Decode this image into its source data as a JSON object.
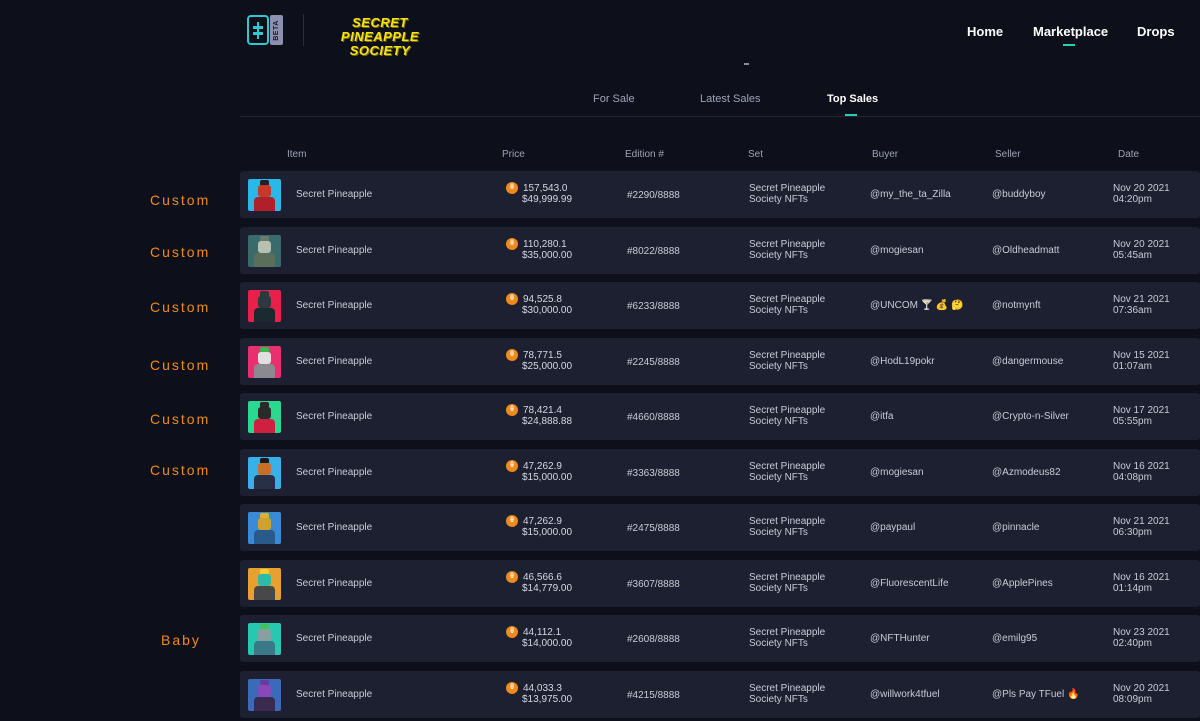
{
  "header": {
    "beta_label": "BETA",
    "brand_line1": "SECRET PINEAPPLE",
    "brand_line2": "SOCIETY",
    "nav": {
      "home": "Home",
      "marketplace": "Marketplace",
      "drops": "Drops"
    },
    "small_dash": "-"
  },
  "tabs": {
    "for_sale": "For Sale",
    "latest_sales": "Latest Sales",
    "top_sales": "Top Sales"
  },
  "columns": {
    "item": "Item",
    "price": "Price",
    "edition": "Edition #",
    "set": "Set",
    "buyer": "Buyer",
    "seller": "Seller",
    "date": "Date"
  },
  "rows": [
    {
      "name": "Secret Pineapple",
      "tfuel": "157,543.0",
      "usd": "$49,999.99",
      "edition": "#2290/8888",
      "set1": "Secret Pineapple",
      "set2": "Society NFTs",
      "buyer": "@my_the_ta_Zilla",
      "seller": "@buddyboy",
      "date1": "Nov 20 2021",
      "date2": "04:20pm",
      "side": "Custom"
    },
    {
      "name": "Secret Pineapple",
      "tfuel": "110,280.1",
      "usd": "$35,000.00",
      "edition": "#8022/8888",
      "set1": "Secret Pineapple",
      "set2": "Society NFTs",
      "buyer": "@mogiesan",
      "seller": "@Oldheadmatt",
      "date1": "Nov 20 2021",
      "date2": "05:45am",
      "side": "Custom"
    },
    {
      "name": "Secret Pineapple",
      "tfuel": "94,525.8",
      "usd": "$30,000.00",
      "edition": "#6233/8888",
      "set1": "Secret Pineapple",
      "set2": "Society NFTs",
      "buyer": "@UNCOM 🍸 💰 🤔",
      "seller": "@notmynft",
      "date1": "Nov 21 2021",
      "date2": "07:36am",
      "side": "Custom"
    },
    {
      "name": "Secret Pineapple",
      "tfuel": "78,771.5",
      "usd": "$25,000.00",
      "edition": "#2245/8888",
      "set1": "Secret Pineapple",
      "set2": "Society NFTs",
      "buyer": "@HodL19pokr",
      "seller": "@dangermouse",
      "date1": "Nov 15 2021",
      "date2": "01:07am",
      "side": "Custom"
    },
    {
      "name": "Secret Pineapple",
      "tfuel": "78,421.4",
      "usd": "$24,888.88",
      "edition": "#4660/8888",
      "set1": "Secret Pineapple",
      "set2": "Society NFTs",
      "buyer": "@itfa",
      "seller": "@Crypto-n-Silver",
      "date1": "Nov 17 2021",
      "date2": "05:55pm",
      "side": "Custom"
    },
    {
      "name": "Secret Pineapple",
      "tfuel": "47,262.9",
      "usd": "$15,000.00",
      "edition": "#3363/8888",
      "set1": "Secret Pineapple",
      "set2": "Society NFTs",
      "buyer": "@mogiesan",
      "seller": "@Azmodeus82",
      "date1": "Nov 16 2021",
      "date2": "04:08pm",
      "side": "Custom"
    },
    {
      "name": "Secret Pineapple",
      "tfuel": "47,262.9",
      "usd": "$15,000.00",
      "edition": "#2475/8888",
      "set1": "Secret Pineapple",
      "set2": "Society NFTs",
      "buyer": "@paypaul",
      "seller": "@pinnacle",
      "date1": "Nov 21 2021",
      "date2": "06:30pm",
      "side": ""
    },
    {
      "name": "Secret Pineapple",
      "tfuel": "46,566.6",
      "usd": "$14,779.00",
      "edition": "#3607/8888",
      "set1": "Secret Pineapple",
      "set2": "Society NFTs",
      "buyer": "@FluorescentLife",
      "seller": "@ApplePines",
      "date1": "Nov 16 2021",
      "date2": "01:14pm",
      "side": ""
    },
    {
      "name": "Secret Pineapple",
      "tfuel": "44,112.1",
      "usd": "$14,000.00",
      "edition": "#2608/8888",
      "set1": "Secret Pineapple",
      "set2": "Society NFTs",
      "buyer": "@NFTHunter",
      "seller": "@emilg95",
      "date1": "Nov 23 2021",
      "date2": "02:40pm",
      "side": "Baby"
    },
    {
      "name": "Secret Pineapple",
      "tfuel": "44,033.3",
      "usd": "$13,975.00",
      "edition": "#4215/8888",
      "set1": "Secret Pineapple",
      "set2": "Society NFTs",
      "buyer": "@willwork4tfuel",
      "seller": "@Pls Pay TFuel 🔥",
      "date1": "Nov 20 2021",
      "date2": "08:09pm",
      "side": ""
    }
  ],
  "thumb_colors": [
    {
      "bg": "#2ab8e8",
      "head": "#c63a2a",
      "body": "#b0202a",
      "crown": "#222222"
    },
    {
      "bg": "#3a6a6a",
      "head": "#b8c0b0",
      "body": "#5a6e5a",
      "crown": "#6a7a70"
    },
    {
      "bg": "#e8204a",
      "head": "#2a3a40",
      "body": "#1a2a30",
      "crown": "#2a3a40"
    },
    {
      "bg": "#e83070",
      "head": "#e0e0e0",
      "body": "#8a8a90",
      "crown": "#3ab84a"
    },
    {
      "bg": "#2ad890",
      "head": "#2a2a2a",
      "body": "#d02040",
      "crown": "#2a2a2a"
    },
    {
      "bg": "#38b0e8",
      "head": "#c8702a",
      "body": "#283048",
      "crown": "#1a1a1a"
    },
    {
      "bg": "#3a8ad8",
      "head": "#d0a030",
      "body": "#2a5a8a",
      "crown": "#e0b030"
    },
    {
      "bg": "#e8a030",
      "head": "#30b8a8",
      "body": "#484848",
      "crown": "#f0d030"
    },
    {
      "bg": "#28c8b0",
      "head": "#88a0a0",
      "body": "#3a7a88",
      "crown": "#40c060"
    },
    {
      "bg": "#3a6ab8",
      "head": "#8848b8",
      "body": "#3a2a50",
      "crown": "#6a3aa0"
    }
  ]
}
